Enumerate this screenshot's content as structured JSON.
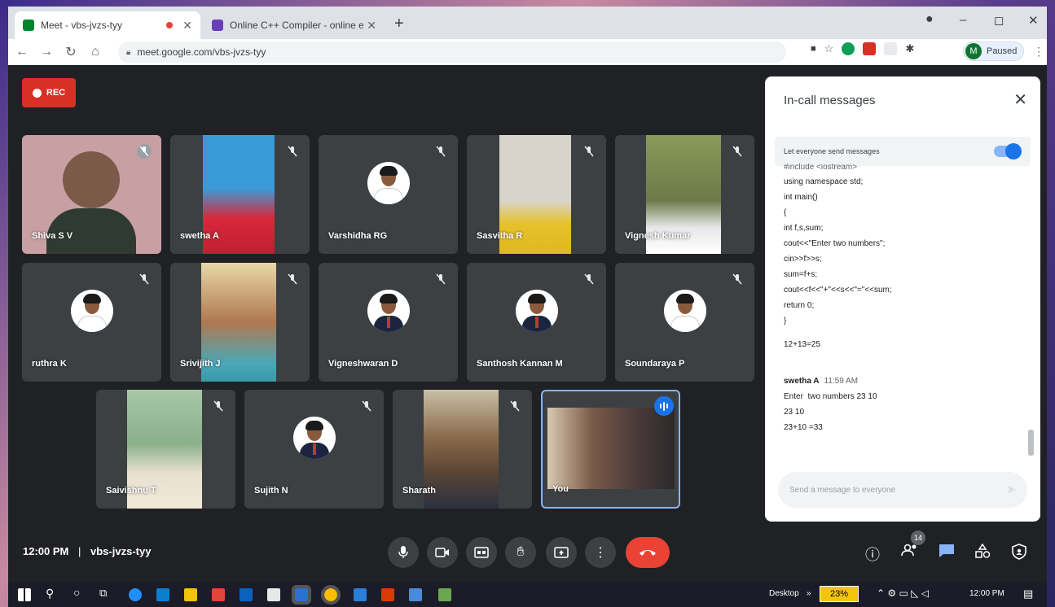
{
  "browser": {
    "tabs": [
      {
        "label": "Meet - vbs-jvzs-tyy",
        "active": true
      },
      {
        "label": "Online C++ Compiler - online e...",
        "active": false
      }
    ],
    "url": "meet.google.com/vbs-jvzs-tyy",
    "profile_initial": "M",
    "profile_status": "Paused",
    "window_controls": [
      "–",
      "◻",
      "✕"
    ]
  },
  "meet": {
    "rec_label": "REC",
    "participants": [
      {
        "name": "Shiva S V"
      },
      {
        "name": "swetha A"
      },
      {
        "name": "Varshidha RG"
      },
      {
        "name": "Sasvitha R"
      },
      {
        "name": "Vignesh Kumar"
      },
      {
        "name": "ruthra K"
      },
      {
        "name": "Srivijith J"
      },
      {
        "name": "Vigneshwaran D"
      },
      {
        "name": "Santhosh Kannan M"
      },
      {
        "name": "Soundaraya P"
      },
      {
        "name": "Saivishnu T"
      },
      {
        "name": "Sujith N"
      },
      {
        "name": "Sharath"
      },
      {
        "name": "You"
      }
    ],
    "time": "12:00 PM",
    "meeting_code": "vbs-jvzs-tyy",
    "participant_count": "14"
  },
  "chat": {
    "title": "In-call messages",
    "permission_label": "Let everyone send messages",
    "code_lines": [
      "#include <iostream>",
      "using namespace std;",
      "int main()",
      "{",
      "int f,s,sum;",
      "cout<<\"Enter two numbers\";",
      "cin>>f>>s;",
      "sum=f+s;",
      "cout<<f<<\"+\"<<s<<\"=\"<<sum;",
      "return 0;",
      "}"
    ],
    "result_line": "12+13=25",
    "last_message": {
      "sender": "swetha A",
      "time": "11:59 AM",
      "lines": [
        "Enter  two numbers 23 10",
        "23 10",
        "23+10 =33"
      ]
    },
    "input_placeholder": "Send a message to everyone"
  },
  "taskbar": {
    "desktop_label": "Desktop",
    "battery": "23%",
    "clock": "12:00 PM"
  }
}
